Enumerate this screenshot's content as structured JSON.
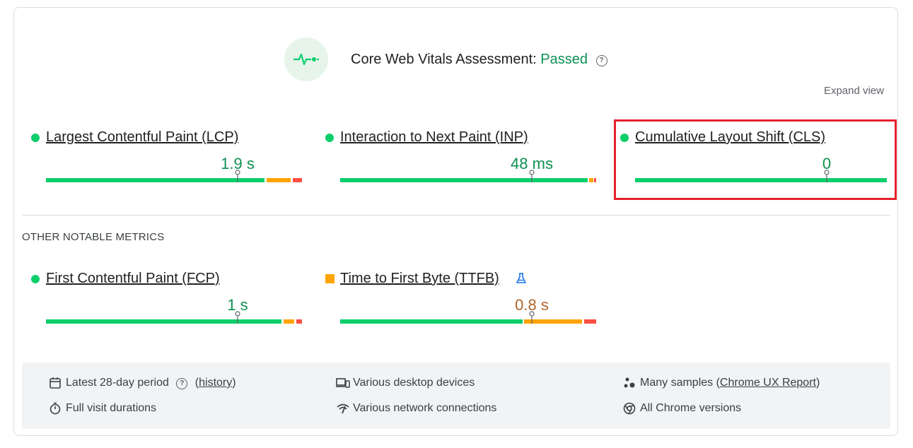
{
  "assessment": {
    "label": "Core Web Vitals Assessment:",
    "status": "Passed",
    "help_glyph": "?",
    "expand_label": "Expand view"
  },
  "core_metrics": [
    {
      "name": "Largest Contentful Paint (LCP)",
      "value": "1.9 s",
      "status": "good"
    },
    {
      "name": "Interaction to Next Paint (INP)",
      "value": "48 ms",
      "status": "good"
    },
    {
      "name": "Cumulative Layout Shift (CLS)",
      "value": "0",
      "status": "good"
    }
  ],
  "other_title": "OTHER NOTABLE METRICS",
  "other_metrics": [
    {
      "name": "First Contentful Paint (FCP)",
      "value": "1 s",
      "status": "good"
    },
    {
      "name": "Time to First Byte (TTFB)",
      "value": "0.8 s",
      "status": "needs-improvement",
      "experimental_icon": "flask-icon"
    }
  ],
  "footer": {
    "period": "Latest 28-day period",
    "history_open": "(",
    "history_link": "history",
    "history_close": ")",
    "durations": "Full visit durations",
    "devices": "Various desktop devices",
    "connections": "Various network connections",
    "samples_prefix": "Many samples (",
    "samples_link": "Chrome UX Report",
    "samples_suffix": ")",
    "chrome_versions": "All Chrome versions"
  },
  "colors": {
    "good": "#0cce6b",
    "average": "#ffa400",
    "poor": "#ff4e42",
    "pass_text": "#0d904f",
    "highlight": "#e5202e"
  }
}
